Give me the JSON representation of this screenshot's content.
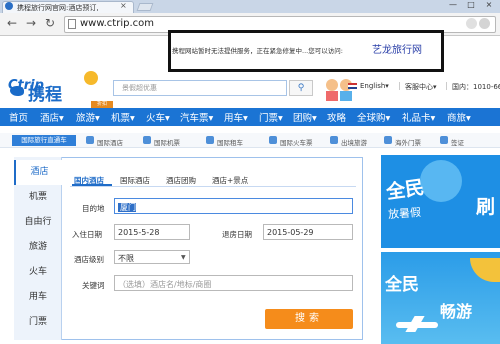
{
  "browser": {
    "tab_title": "携程旅行网官网:酒店预订,",
    "tab_close": "×",
    "url": "www.ctrip.com",
    "minimize": "—",
    "maximize": "□",
    "close": "×"
  },
  "notice": {
    "text": "携程网站暂时无法提供服务，正在紧急修复中...您可以访问:",
    "link": "艺龙旅行网"
  },
  "header": {
    "logo_mark": "Ctrip",
    "logo_name": "携程",
    "logo_tag": "折扣",
    "search_placeholder": "景假超优惠",
    "language": "English",
    "language_arrow": "▾",
    "service": "客服中心",
    "service_arrow": "▾",
    "hotline": "国内：1010-66"
  },
  "mainnav": {
    "items": [
      {
        "label": "首页"
      },
      {
        "label": "酒店",
        "arrow": "▾"
      },
      {
        "label": "旅游",
        "arrow": "▾"
      },
      {
        "label": "机票",
        "arrow": "▾"
      },
      {
        "label": "火车",
        "arrow": "▾"
      },
      {
        "label": "汽车票",
        "arrow": "▾"
      },
      {
        "label": "用车",
        "arrow": "▾"
      },
      {
        "label": "门票",
        "arrow": "▾"
      },
      {
        "label": "团购",
        "arrow": "▾"
      },
      {
        "label": "攻略"
      },
      {
        "label": "全球购",
        "arrow": "▾"
      },
      {
        "label": "礼品卡",
        "arrow": "▾"
      },
      {
        "label": "商旅",
        "arrow": "▾"
      }
    ]
  },
  "subnav": {
    "lead": "国际旅行直通车",
    "items": [
      "国际酒店",
      "国际机票",
      "国际租车",
      "国际火车票",
      "出境旅游",
      "海外门票",
      "签证"
    ]
  },
  "side": {
    "items": [
      "酒店",
      "机票",
      "自由行",
      "旅游",
      "火车",
      "用车",
      "门票"
    ]
  },
  "panel": {
    "tabs": [
      "国内酒店",
      "国际酒店",
      "酒店团购",
      "酒店+景点"
    ],
    "destination_label": "目的地",
    "destination_value": "厦门",
    "checkin_label": "入住日期",
    "checkin_value": "2015-5-28",
    "checkout_label": "退房日期",
    "checkout_value": "2015-05-29",
    "star_label": "酒店级别",
    "star_value": "不限",
    "keyword_label": "关键词",
    "keyword_placeholder": "（选填）酒店名/地标/商圈",
    "search_button": "搜索"
  },
  "ads": {
    "ad1_main": "全民",
    "ad1_sub": "放暑假",
    "ad1_right": "刷",
    "ad2_line1": "全民",
    "ad2_line2": "畅游"
  }
}
